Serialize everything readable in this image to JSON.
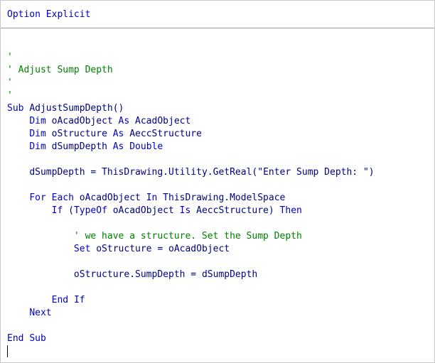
{
  "editor": {
    "header_lines": [
      {
        "kind": "comment",
        "text": "'"
      },
      {
        "kind": "code",
        "text": "Option Explicit"
      }
    ],
    "code_lines": [
      {
        "kind": "blank",
        "text": ""
      },
      {
        "kind": "blank",
        "text": ""
      },
      {
        "kind": "comment",
        "text": "'"
      },
      {
        "kind": "comment",
        "text": "' Adjust Sump Depth"
      },
      {
        "kind": "comment",
        "text": "'"
      },
      {
        "kind": "comment",
        "text": "'"
      },
      {
        "kind": "code",
        "text": "Sub AdjustSumpDepth()"
      },
      {
        "kind": "code",
        "text": "    Dim oAcadObject As AcadObject"
      },
      {
        "kind": "code",
        "text": "    Dim oStructure As AeccStructure"
      },
      {
        "kind": "code",
        "text": "    Dim dSumpDepth As Double"
      },
      {
        "kind": "blank",
        "text": ""
      },
      {
        "kind": "code",
        "text": "    dSumpDepth = ThisDrawing.Utility.GetReal(\"Enter Sump Depth: \")"
      },
      {
        "kind": "blank",
        "text": ""
      },
      {
        "kind": "code",
        "text": "    For Each oAcadObject In ThisDrawing.ModelSpace"
      },
      {
        "kind": "code",
        "text": "        If (TypeOf oAcadObject Is AeccStructure) Then"
      },
      {
        "kind": "blank",
        "text": ""
      },
      {
        "kind": "comment",
        "text": "            ' we have a structure. Set the Sump Depth"
      },
      {
        "kind": "code",
        "text": "            Set oStructure = oAcadObject"
      },
      {
        "kind": "blank",
        "text": ""
      },
      {
        "kind": "code",
        "text": "            oStructure.SumpDepth = dSumpDepth"
      },
      {
        "kind": "blank",
        "text": ""
      },
      {
        "kind": "code",
        "text": "        End If"
      },
      {
        "kind": "code",
        "text": "    Next"
      },
      {
        "kind": "blank",
        "text": ""
      },
      {
        "kind": "code",
        "text": "End Sub"
      }
    ],
    "keywords": [
      "Option",
      "Explicit",
      "Sub",
      "Dim",
      "As",
      "Double",
      "For",
      "Each",
      "In",
      "If",
      "TypeOf",
      "Is",
      "Then",
      "Set",
      "End",
      "Next"
    ],
    "colors": {
      "keyword": "#0000c0",
      "identifier": "#000080",
      "comment": "#008000",
      "separator": "#9a9a9a",
      "background": "#ffffff"
    }
  }
}
